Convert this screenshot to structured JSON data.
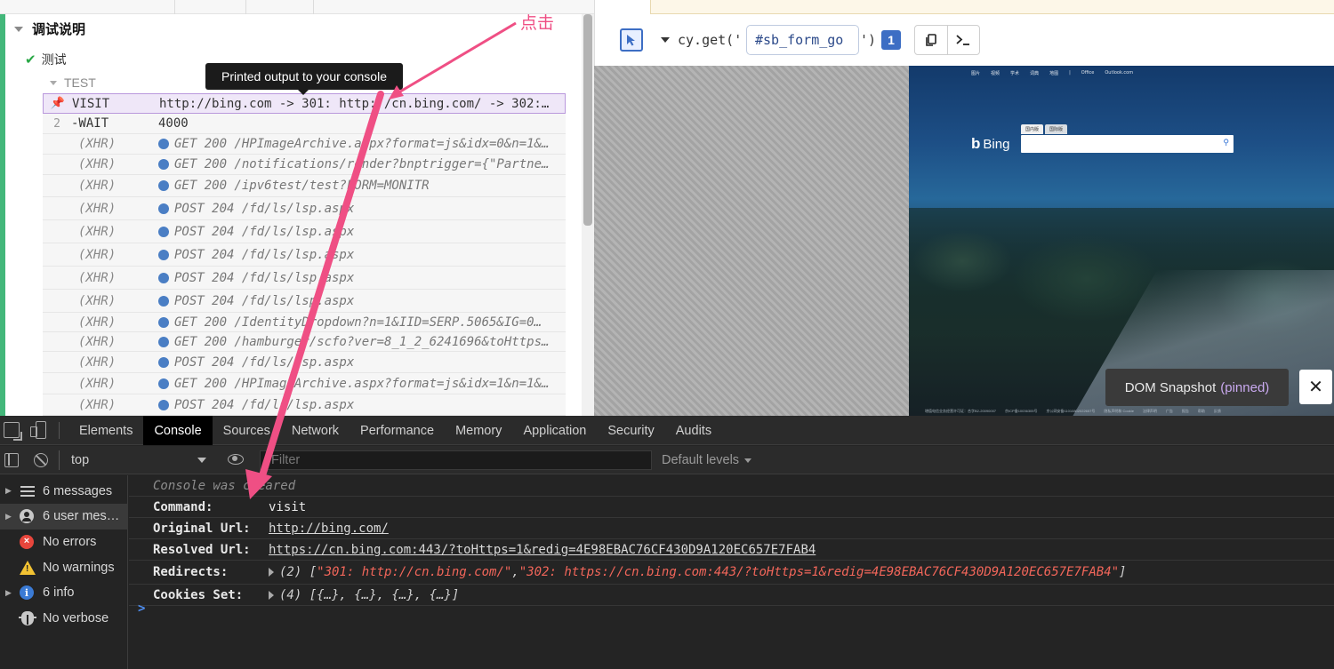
{
  "runner": {
    "suite_title": "调试说明",
    "test_title": "测试",
    "block_title": "TEST",
    "tooltip": "Printed output to your console",
    "commands": [
      {
        "num": "",
        "name": "VISIT",
        "message": "http://bing.com -> 301: http://cn.bing.com/ -> 302:…",
        "kind": "pinned"
      },
      {
        "num": "2",
        "name": "-WAIT",
        "message": "4000",
        "kind": "normal"
      },
      {
        "num": "",
        "name": "(XHR)",
        "message": "GET 200 /HPImageArchive.aspx?format=js&idx=0&n=1&…",
        "kind": "xhr"
      },
      {
        "num": "",
        "name": "(XHR)",
        "message": "GET 200 /notifications/render?bnptrigger={\"Partne…",
        "kind": "xhr"
      },
      {
        "num": "",
        "name": "(XHR)",
        "message": "GET 200 /ipv6test/test?FORM=MONITR",
        "kind": "xhr"
      },
      {
        "num": "",
        "name": "(XHR)",
        "message": "POST 204 /fd/ls/lsp.aspx",
        "kind": "xhr"
      },
      {
        "num": "",
        "name": "(XHR)",
        "message": "POST 204 /fd/ls/lsp.aspx",
        "kind": "xhr"
      },
      {
        "num": "",
        "name": "(XHR)",
        "message": "POST 204 /fd/ls/lsp.aspx",
        "kind": "xhr"
      },
      {
        "num": "",
        "name": "(XHR)",
        "message": "POST 204 /fd/ls/lsp.aspx",
        "kind": "xhr"
      },
      {
        "num": "",
        "name": "(XHR)",
        "message": "POST 204 /fd/ls/lsp.aspx",
        "kind": "xhr"
      },
      {
        "num": "",
        "name": "(XHR)",
        "message": "GET 200 /IdentityDropdown?n=1&IID=SERP.5065&IG=0…",
        "kind": "xhr"
      },
      {
        "num": "",
        "name": "(XHR)",
        "message": "GET 200 /hamburger/scfo?ver=8_1_2_6241696&toHttps…",
        "kind": "xhr"
      },
      {
        "num": "",
        "name": "(XHR)",
        "message": "POST 204 /fd/ls/lsp.aspx",
        "kind": "xhr"
      },
      {
        "num": "",
        "name": "(XHR)",
        "message": "GET 200 /HPImageArchive.aspx?format=js&idx=1&n=1&…",
        "kind": "xhr"
      },
      {
        "num": "",
        "name": "(XHR)",
        "message": "POST 204 /fd/ls/lsp.aspx",
        "kind": "xhr"
      }
    ]
  },
  "selector_playground": {
    "prefix": "cy.get('",
    "selector": "#sb_form_go",
    "suffix": "')",
    "match_count": "1",
    "copy_icon": "copy-icon",
    "print_icon": "terminal-icon"
  },
  "preview": {
    "bing_logo": "Bing",
    "bing_nav": [
      "图片",
      "视频",
      "学术",
      "词典",
      "地图",
      "|",
      "Office",
      "Outlook.com"
    ],
    "bing_tabs": [
      "国内版",
      "国际版"
    ],
    "bing_footer": [
      "增值电信业务经营许可证：合字B2-20090007",
      "京ICP备10036305号",
      "京公网安备11010802022657号",
      "隐私声明和 Cookie",
      "法律声明",
      "广告",
      "报告",
      "帮助",
      "反馈"
    ],
    "snapshot_text": "DOM Snapshot",
    "snapshot_pinned": "(pinned)",
    "close_label": "✕"
  },
  "devtools": {
    "tabs": [
      "Elements",
      "Console",
      "Sources",
      "Network",
      "Performance",
      "Memory",
      "Application",
      "Security",
      "Audits"
    ],
    "active_tab": "Console",
    "context": "top",
    "filter_placeholder": "Filter",
    "levels": "Default levels",
    "sidebar": [
      {
        "label": "6 messages",
        "icon": "list-icon",
        "arrow": true
      },
      {
        "label": "6 user mes…",
        "icon": "user-icon",
        "arrow": true
      },
      {
        "label": "No errors",
        "icon": "error-icon",
        "arrow": false
      },
      {
        "label": "No warnings",
        "icon": "warning-icon",
        "arrow": false
      },
      {
        "label": "6 info",
        "icon": "info-icon",
        "arrow": true
      },
      {
        "label": "No verbose",
        "icon": "bug-icon",
        "arrow": false
      }
    ],
    "console": {
      "cleared": "Console was cleared",
      "command_key": "Command:",
      "command_val": "visit",
      "original_key": "Original Url:",
      "original_val": "http://bing.com/",
      "resolved_key": "Resolved Url:",
      "resolved_val": "https://cn.bing.com:443/?toHttps=1&redig=4E98EBAC76CF430D9A120EC657E7FAB4",
      "redirects_key": "Redirects:",
      "redirects_count": "(2) [",
      "redirect_1": "\"301: http://cn.bing.com/\"",
      "redirect_sep": ", ",
      "redirect_2": "\"302: https://cn.bing.com:443/?toHttps=1&redig=4E98EBAC76CF430D9A120EC657E7FAB4\"",
      "redirects_end": "]",
      "cookies_key": "Cookies Set:",
      "cookies_val": "(4) [{…}, {…}, {…}, {…}]",
      "prompt": ">"
    }
  },
  "annotation": {
    "label": "点击",
    "color": "#ef4f84"
  }
}
